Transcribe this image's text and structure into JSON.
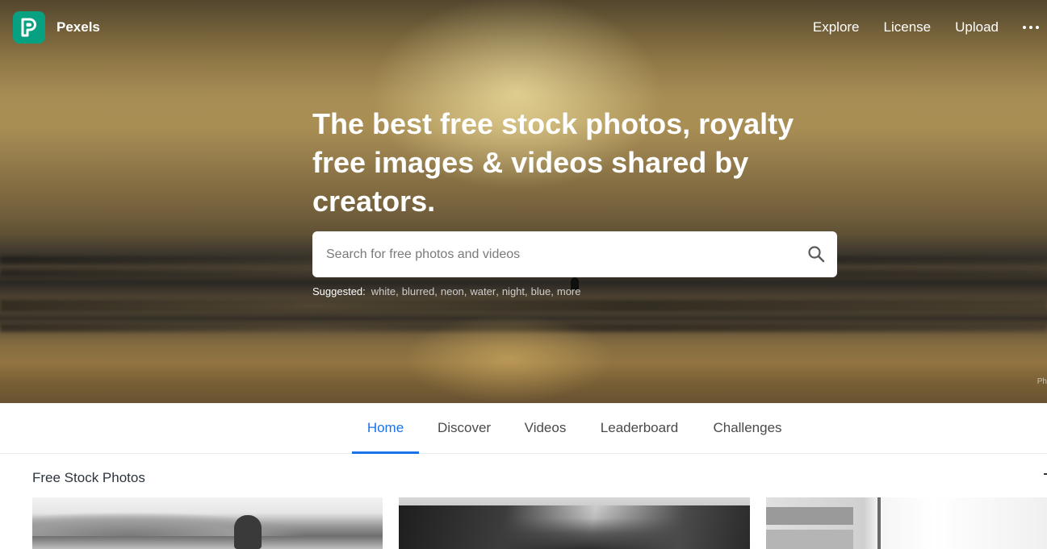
{
  "brand": {
    "name": "Pexels",
    "logo_icon": "pexels-logo-icon",
    "logo_color": "#07a081"
  },
  "topnav": {
    "items": [
      "Explore",
      "License",
      "Upload"
    ],
    "more_icon": "more-horizontal-icon"
  },
  "hero": {
    "headline": "The best free stock photos, royalty free images & videos shared by creators.",
    "search": {
      "placeholder": "Search for free photos and videos",
      "icon": "search-icon"
    },
    "suggested": {
      "label": "Suggested:",
      "tags": [
        "white",
        "blurred",
        "neon",
        "water",
        "night",
        "blue",
        "more"
      ]
    },
    "photo_credit": "Ph"
  },
  "tabs": {
    "items": [
      "Home",
      "Discover",
      "Videos",
      "Leaderboard",
      "Challenges"
    ],
    "active": "Home",
    "accent_color": "#1a73e8"
  },
  "main": {
    "section_title": "Free Stock Photos"
  }
}
